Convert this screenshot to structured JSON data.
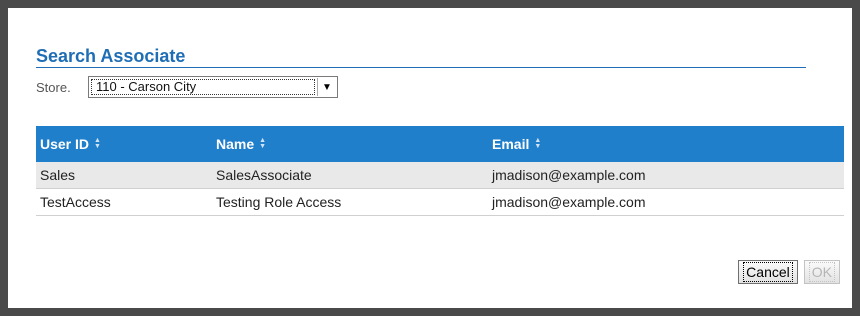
{
  "dialog": {
    "title": "Search Associate",
    "store_label": "Store.",
    "store_value": "110 - Carson City",
    "buttons": {
      "cancel": "Cancel",
      "ok": "OK"
    }
  },
  "table": {
    "headers": [
      "User ID",
      "Name",
      "Email"
    ],
    "rows": [
      [
        "Sales",
        "SalesAssociate",
        "jmadison@example.com"
      ],
      [
        "TestAccess",
        "Testing Role Access",
        "jmadison@example.com"
      ]
    ]
  },
  "colors": {
    "header": "#1f7fcb",
    "title": "#1f6eb5"
  },
  "icons": [
    "sort-icon",
    "chevron-down-icon"
  ]
}
